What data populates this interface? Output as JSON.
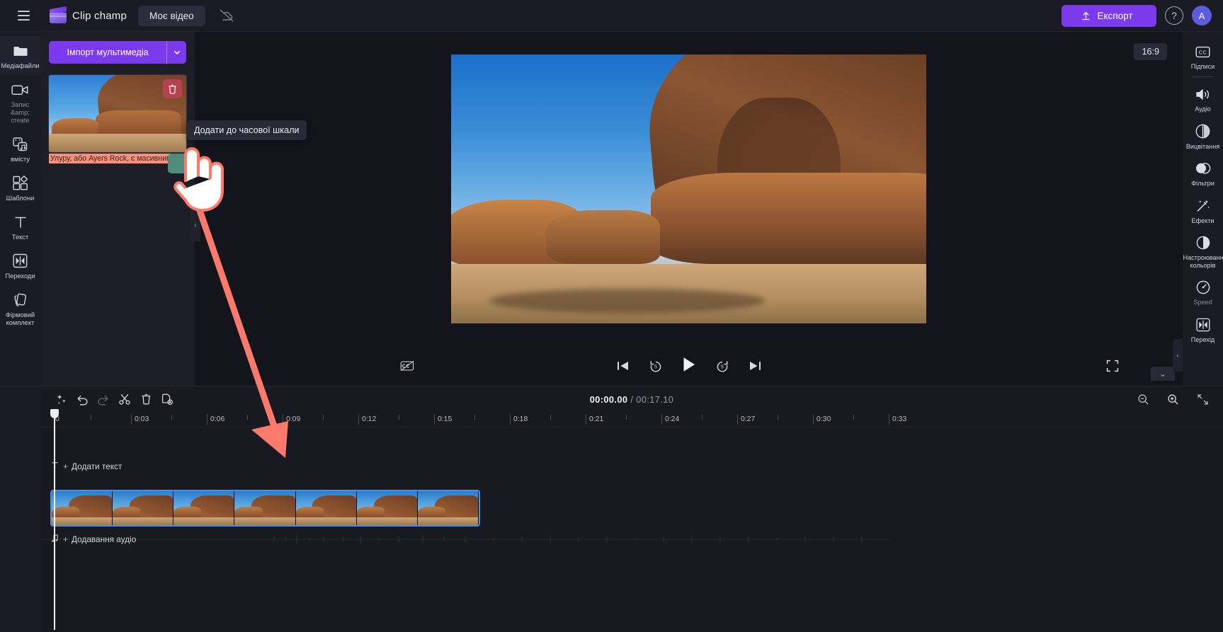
{
  "app": {
    "brand": "Clip champ",
    "project_button": "Моє відео",
    "menu_icon": "hamburger-icon",
    "cloud_off_icon": "cloud-off-icon"
  },
  "topbar": {
    "export_label": "Експорт",
    "export_icon": "upload-icon",
    "help_label": "?",
    "avatar_label": "A",
    "accent": "#7b3bed"
  },
  "left_rail": {
    "items": [
      {
        "label": "Медіафайли",
        "icon": "folder-icon",
        "active": true
      },
      {
        "label": "Запис &amp; create",
        "icon": "camera-icon",
        "active": false
      },
      {
        "label": "вмісту",
        "icon": "stock-content-icon",
        "active": false
      },
      {
        "label": "Шаблони",
        "icon": "templates-icon",
        "active": false
      },
      {
        "label": "Текст",
        "icon": "text-icon",
        "active": false
      },
      {
        "label": "Переходи",
        "icon": "transitions-icon",
        "active": false
      },
      {
        "label": "Фірмовий комплект",
        "icon": "brand-kit-icon",
        "active": false
      }
    ]
  },
  "media_panel": {
    "import_label": "Імпорт мультимедіа",
    "import_dropdown_icon": "chevron-down-icon",
    "thumbnail": {
      "caption": "Улуру, або Ayers Rock, є масивним s.",
      "delete_icon": "trash-icon",
      "add_icon": "plus-icon",
      "caption_highlight_color": "#f98f7a"
    },
    "tooltip": "Додати до часової шкали",
    "collapse_icon": "chevron-left-icon"
  },
  "preview": {
    "ratio_badge": "16:9",
    "alt": "Uluru Ayers Rock landscape"
  },
  "transport": {
    "captions_off_icon": "captions-off-icon",
    "skip_start_icon": "skip-to-start-icon",
    "back5_icon": "rewind-5-icon",
    "play_icon": "play-icon",
    "fwd5_icon": "forward-5-icon",
    "skip_end_icon": "skip-to-end-icon",
    "fullscreen_icon": "fullscreen-icon",
    "back5_label": "5",
    "fwd5_label": "5"
  },
  "right_rail": {
    "items": [
      {
        "label": "Підписи",
        "icon": "closed-captions-icon",
        "divider_after": true
      },
      {
        "label": "Аудіо",
        "icon": "speaker-icon",
        "divider_after": false
      },
      {
        "label": "Вицвітання",
        "icon": "fade-icon",
        "divider_after": false
      },
      {
        "label": "Фільтри",
        "icon": "filters-icon",
        "divider_after": false
      },
      {
        "label": "Ефекти",
        "icon": "effects-wand-icon",
        "divider_after": false
      },
      {
        "label": "Настроювання кольорів",
        "icon": "color-adjust-icon",
        "divider_after": false
      },
      {
        "label": "Speed",
        "icon": "speedometer-icon",
        "divider_after": false
      },
      {
        "label": "Перехід",
        "icon": "transition-icon",
        "divider_after": false
      }
    ],
    "collapse_icon": "chevron-left-icon"
  },
  "timeline": {
    "toolbar": [
      {
        "icon": "magic-sparkle-icon",
        "dim": false
      },
      {
        "icon": "undo-icon",
        "dim": false
      },
      {
        "icon": "redo-icon",
        "dim": true
      },
      {
        "icon": "scissors-icon",
        "dim": false
      },
      {
        "icon": "trash-icon",
        "dim": false
      },
      {
        "icon": "duplicate-icon",
        "dim": false
      }
    ],
    "current_time": "00:00.00",
    "separator": "/",
    "total_time": "00:17.10",
    "toolbar_right": [
      {
        "icon": "zoom-out-icon"
      },
      {
        "icon": "zoom-in-icon"
      },
      {
        "icon": "fit-timeline-icon"
      }
    ],
    "ruler_ticks": [
      "0",
      "0:03",
      "0:06",
      "0:09",
      "0:12",
      "0:15",
      "0:18",
      "0:21",
      "0:24",
      "0:27",
      "0:30",
      "0:33"
    ],
    "tracks": {
      "text_track_label": "Додати текст",
      "text_track_icon": "text-t-icon",
      "audio_track_label": "Додавання аудіо",
      "audio_track_icon": "music-note-icon",
      "plus": "+"
    },
    "clip_border_color": "#4a8fe0",
    "expand_icon": "chevron-down-icon"
  },
  "annotation": {
    "cursor": "hand-pointer-cursor",
    "arrow_color": "#fb7a6b"
  }
}
